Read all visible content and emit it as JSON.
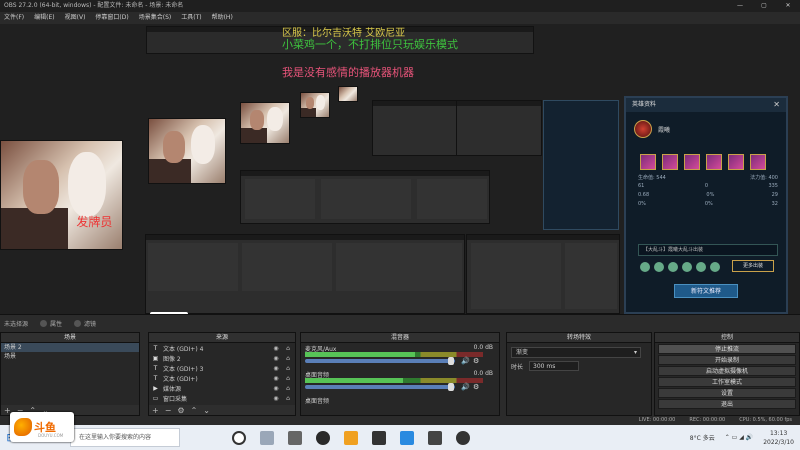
{
  "window": {
    "title": "OBS 27.2.0 (64-bit, windows) - 配置文件: 未命名 - 场景: 未命名",
    "controls": [
      "—",
      "▢",
      "✕"
    ]
  },
  "menu": [
    "文件(F)",
    "编辑(E)",
    "视图(V)",
    "停靠窗口(D)",
    "场景集合(S)",
    "工具(T)",
    "帮助(H)"
  ],
  "overlay": {
    "line1": "区服：比尔吉沃特 艾欧尼亚",
    "line2": "小菜鸡一个，不打排位只玩娱乐模式",
    "line3": "我是没有感情的播放器机器"
  },
  "photos": {
    "tag": "发牌员"
  },
  "hero_card": {
    "header": "英雄资料",
    "close": "✕",
    "name": "霞曦",
    "stats": [
      [
        "生命值: 544",
        "法力值: 400"
      ],
      [
        "61",
        "0",
        "335"
      ],
      [
        "0.68",
        "0%",
        "29"
      ],
      [
        "0%",
        "0%",
        "32"
      ]
    ],
    "select_text": "【大乱斗】霞曦大乱斗出装",
    "rune_button": "更多出装",
    "new_button": "新符文推荐"
  },
  "mini_logo": "斗鱼",
  "status_strip": {
    "label": "未选择源",
    "props": "属性",
    "filters": "滤镜"
  },
  "scenes": {
    "title": "场景",
    "items": [
      "场景 2",
      "场景"
    ]
  },
  "sources": {
    "title": "来源",
    "items": [
      {
        "icon": "T",
        "label": "文本 (GDI+) 4"
      },
      {
        "icon": "▣",
        "label": "图像 2"
      },
      {
        "icon": "T",
        "label": "文本 (GDI+) 3"
      },
      {
        "icon": "T",
        "label": "文本 (GDI+)"
      },
      {
        "icon": "▶",
        "label": "媒体源"
      },
      {
        "icon": "▭",
        "label": "窗口采集"
      }
    ]
  },
  "mixer": {
    "title": "混音器",
    "channels": [
      {
        "name": "麦克风/Aux",
        "db": "0.0 dB",
        "level": 0.62,
        "fader": 0.97
      },
      {
        "name": "桌面音频",
        "db": "0.0 dB",
        "level": 0.55,
        "fader": 0.97
      },
      {
        "name": "桌面音频",
        "db": "",
        "level": 0,
        "fader": 0.97
      }
    ]
  },
  "transitions": {
    "title": "转场特效",
    "selected": "渐变",
    "duration_label": "时长",
    "duration_value": "300 ms"
  },
  "controls": {
    "title": "控制",
    "buttons": [
      "停止推流",
      "开始录制",
      "启动虚拟摄像机",
      "工作室模式",
      "设置",
      "退出"
    ]
  },
  "statusbar": {
    "live": "LIVE: 00:00:00",
    "rec": "REC: 00:00:00",
    "cpu": "CPU: 0.5%, 60.00 fps"
  },
  "taskbar": {
    "search_placeholder": "在这里输入你要搜索的内容",
    "weather": "8°C 多云",
    "time": "13:13",
    "date": "2022/3/10"
  },
  "logo": {
    "text": "斗鱼",
    "sub": "DOUYU.COM"
  },
  "colors": {
    "overlay_yellow": "#d8c84a",
    "overlay_green": "#3ec43e",
    "overlay_pink": "#e8547a",
    "accent_blue": "#1f5a8a"
  }
}
